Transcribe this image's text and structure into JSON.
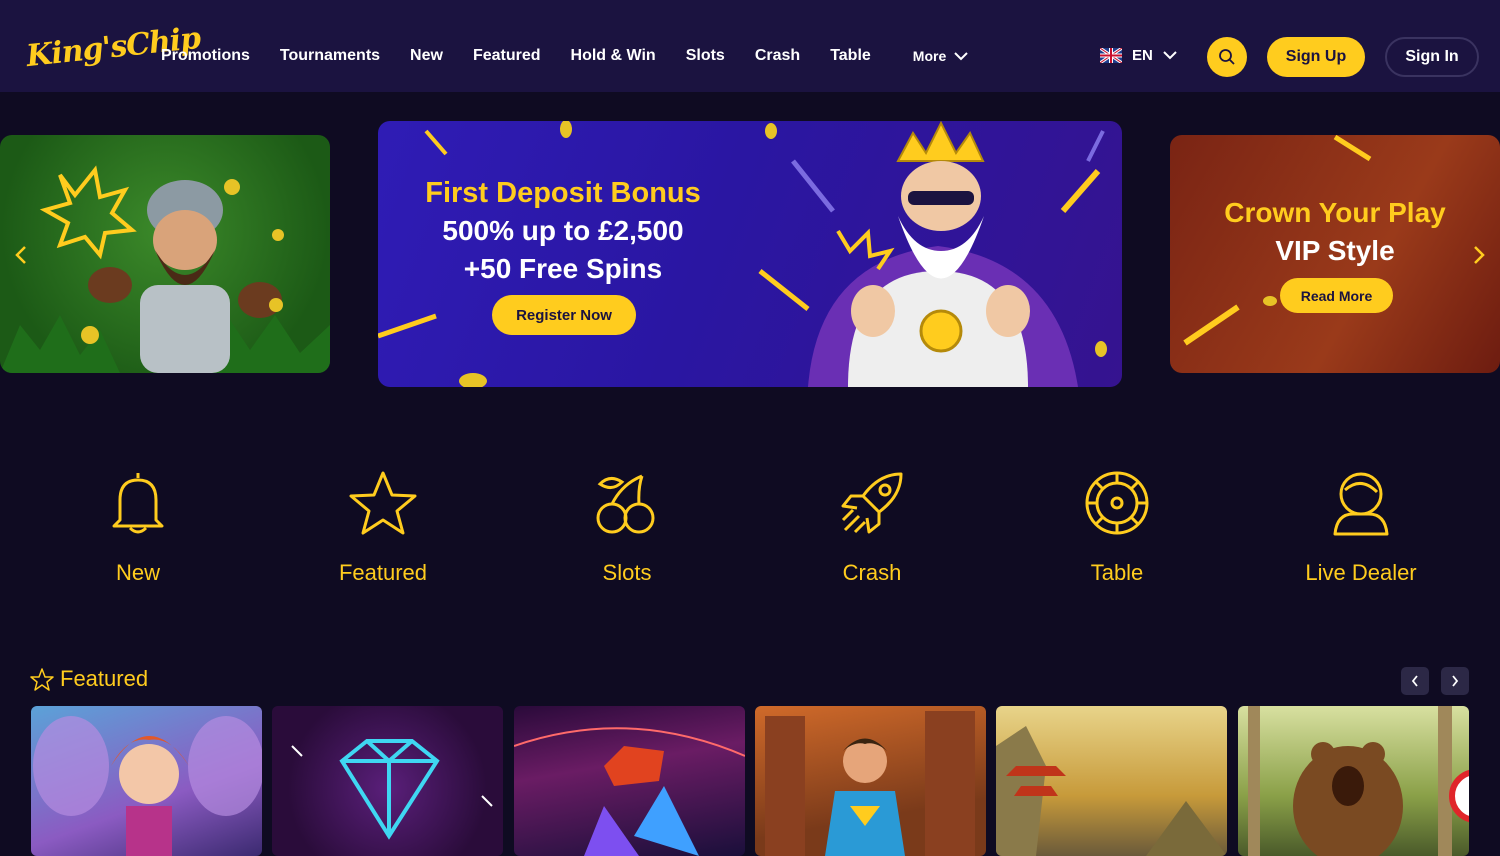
{
  "header": {
    "logo_text": "King'sChip",
    "nav": [
      "Promotions",
      "Tournaments",
      "New",
      "Featured",
      "Hold & Win",
      "Slots",
      "Crash",
      "Table"
    ],
    "more_label": "More",
    "language": "EN",
    "signup_label": "Sign Up",
    "signin_label": "Sign In"
  },
  "banners": {
    "center": {
      "title": "First Deposit Bonus",
      "line2": "500% up to £2,500",
      "line3": "+50 Free Spins",
      "button": "Register Now"
    },
    "right": {
      "title": "Crown Your Play",
      "line2": "VIP Style",
      "button": "Read More"
    }
  },
  "categories": [
    {
      "label": "New",
      "icon": "bell-icon"
    },
    {
      "label": "Featured",
      "icon": "star-icon"
    },
    {
      "label": "Slots",
      "icon": "cherries-icon"
    },
    {
      "label": "Crash",
      "icon": "rocket-icon"
    },
    {
      "label": "Table",
      "icon": "roulette-icon"
    },
    {
      "label": "Live Dealer",
      "icon": "dealer-icon"
    }
  ],
  "featured_section": {
    "title": "Featured"
  },
  "colors": {
    "accent": "#ffcc1e",
    "header_bg": "#1b1340",
    "page_bg": "#0f0b22"
  }
}
